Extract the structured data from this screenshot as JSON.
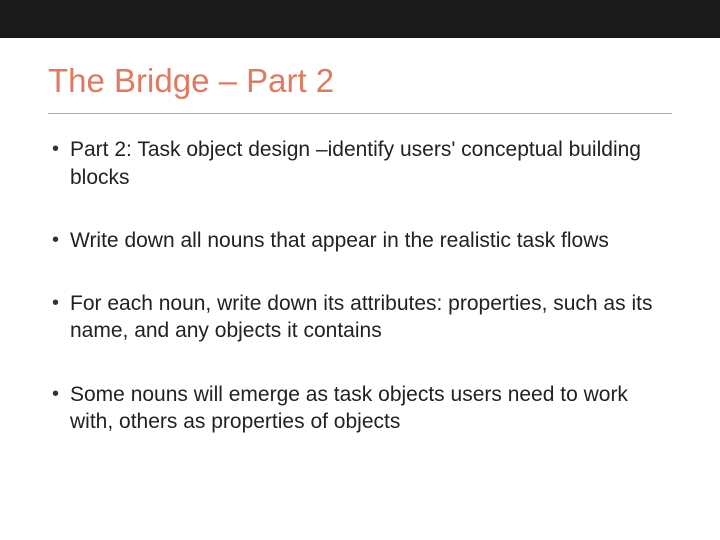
{
  "slide": {
    "title": "The Bridge – Part 2",
    "bullets": [
      "Part 2: Task object design –identify users' conceptual building blocks",
      " Write down all nouns that appear in the realistic task flows",
      " For each noun, write down its attributes: properties, such as its name, and any objects it contains",
      " Some nouns will emerge as task objects users need to work with, others as properties of objects"
    ]
  }
}
